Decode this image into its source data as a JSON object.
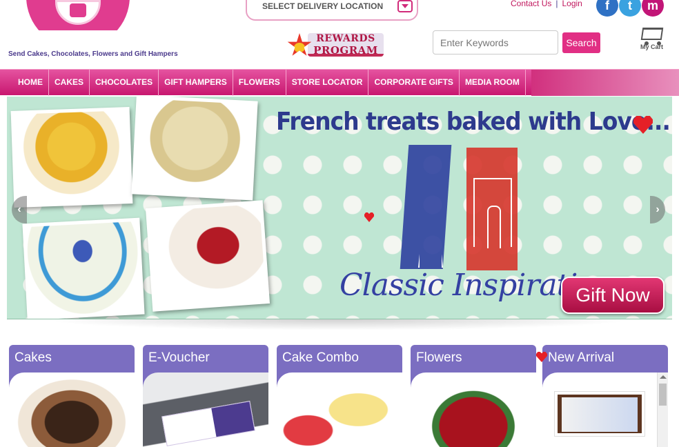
{
  "header": {
    "tagline": "Send Cakes, Chocolates, Flowers and Gift Hampers",
    "delivery_location": "SELECT DELIVERY LOCATION",
    "rewards_line1": "REWARDS",
    "rewards_line2": "PROGRAM",
    "contact_us": "Contact Us",
    "separator": "|",
    "login": "Login",
    "social": {
      "facebook": "f",
      "twitter": "t",
      "other": "m"
    },
    "search_placeholder": "Enter Keywords",
    "search_button": "Search",
    "cart_label": "My Cart"
  },
  "nav": {
    "items": [
      "HOME",
      "CAKES",
      "CHOCOLATES",
      "GIFT HAMPERS",
      "FLOWERS",
      "STORE LOCATOR",
      "CORPORATE GIFTS",
      "MEDIA ROOM"
    ]
  },
  "banner": {
    "title": "French treats baked with Love...",
    "subtitle": "Classic Inspiration",
    "cta": "Gift Now",
    "prev_icon": "‹",
    "next_icon": "›"
  },
  "categories": [
    {
      "title": "Cakes"
    },
    {
      "title": "E-Voucher"
    },
    {
      "title": "Cake Combo"
    },
    {
      "title": "Flowers"
    },
    {
      "title": "New Arrival"
    }
  ],
  "colors": {
    "brand_pink": "#e12f84",
    "brand_purple": "#4b3a8c",
    "tile_purple": "#7b6ec1",
    "banner_mint": "#bfe6d3"
  }
}
